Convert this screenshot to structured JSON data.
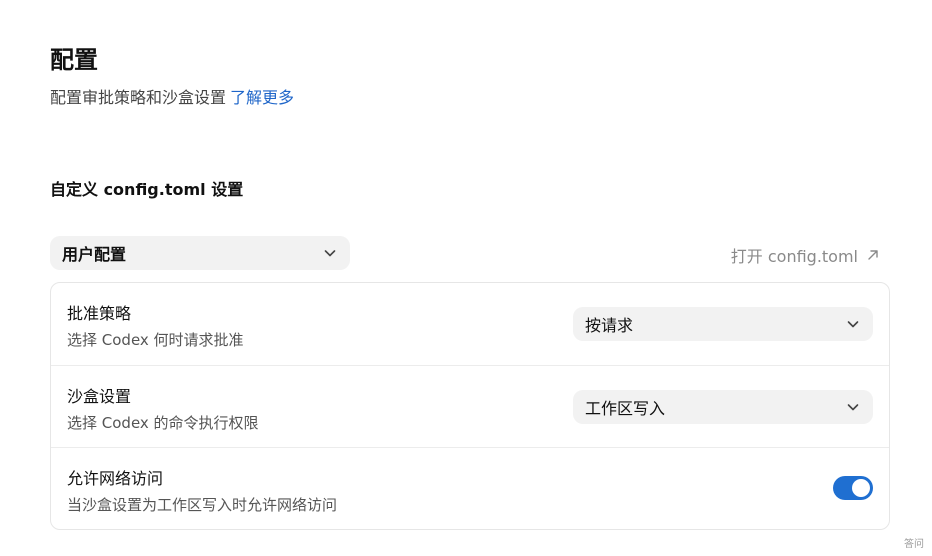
{
  "header": {
    "title": "配置",
    "subtitle": "配置审批策略和沙盒设置",
    "learn_more": "了解更多"
  },
  "section": {
    "title": "自定义 config.toml 设置"
  },
  "profile": {
    "selected": "用户配置"
  },
  "open_config": {
    "label": "打开 config.toml"
  },
  "settings": {
    "approval": {
      "title": "批准策略",
      "description": "选择 Codex 何时请求批准",
      "value": "按请求"
    },
    "sandbox": {
      "title": "沙盒设置",
      "description": "选择 Codex 的命令执行权限",
      "value": "工作区写入"
    },
    "network": {
      "title": "允许网络访问",
      "description": "当沙盒设置为工作区写入时允许网络访问",
      "enabled": true
    }
  },
  "watermark": {
    "text": "答问"
  },
  "colors": {
    "link": "#1f66c9",
    "toggle_on": "#1f6fd1",
    "select_bg": "#f2f2f2"
  }
}
